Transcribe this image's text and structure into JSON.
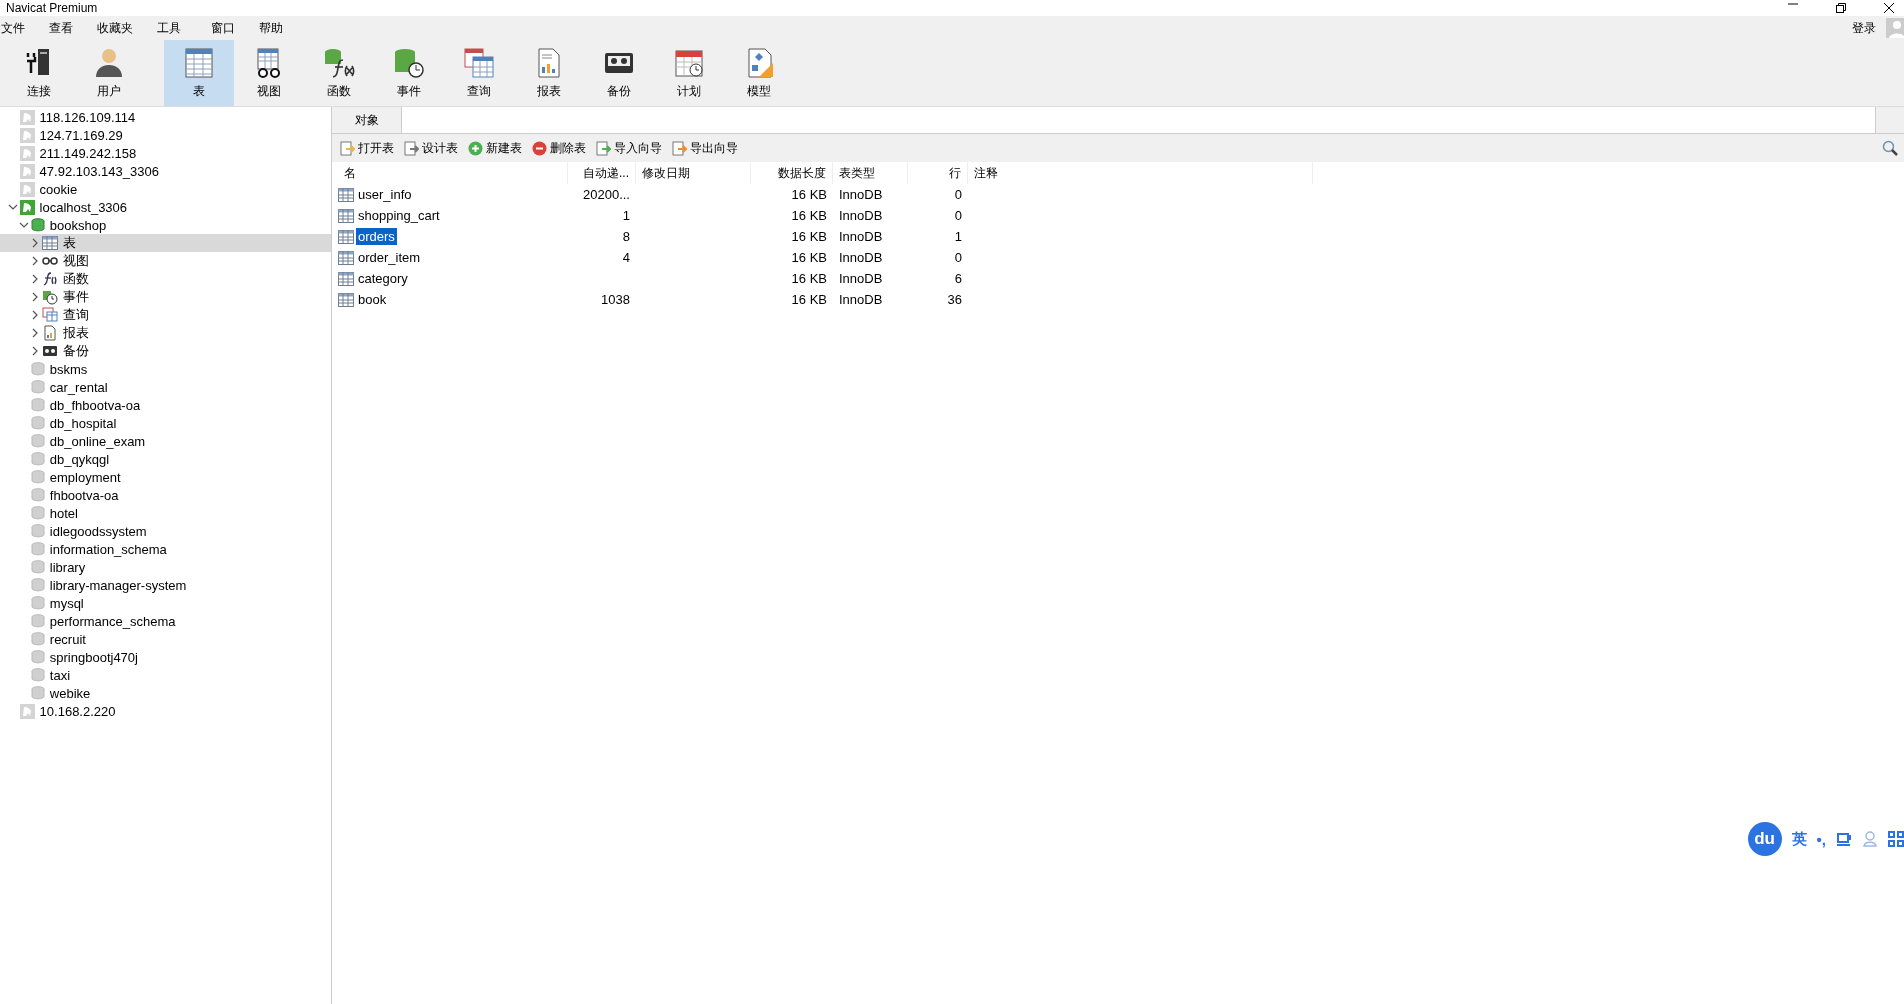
{
  "window": {
    "title": "Navicat Premium"
  },
  "menu": [
    "文件",
    "查看",
    "收藏夹",
    "工具",
    "窗口",
    "帮助"
  ],
  "login": "登录",
  "toolbar": [
    {
      "kind": "connect",
      "label": "连接",
      "selected": false
    },
    {
      "kind": "user",
      "label": "用户",
      "selected": false
    },
    {
      "kind": "table",
      "label": "表",
      "selected": true
    },
    {
      "kind": "view",
      "label": "视图",
      "selected": false
    },
    {
      "kind": "function",
      "label": "函数",
      "selected": false
    },
    {
      "kind": "event",
      "label": "事件",
      "selected": false
    },
    {
      "kind": "query",
      "label": "查询",
      "selected": false
    },
    {
      "kind": "report",
      "label": "报表",
      "selected": false
    },
    {
      "kind": "backup",
      "label": "备份",
      "selected": false
    },
    {
      "kind": "schedule",
      "label": "计划",
      "selected": false
    },
    {
      "kind": "model",
      "label": "模型",
      "selected": false
    }
  ],
  "sidebar": {
    "items": [
      {
        "kind": "connection",
        "label": "118.126.109.114",
        "connected": false,
        "selected": false
      },
      {
        "kind": "connection",
        "label": "124.71.169.29",
        "connected": false,
        "selected": false
      },
      {
        "kind": "connection",
        "label": "211.149.242.158",
        "connected": false,
        "selected": false
      },
      {
        "kind": "connection",
        "label": "47.92.103.143_3306",
        "connected": false,
        "selected": false
      },
      {
        "kind": "connection",
        "label": "cookie",
        "connected": false,
        "selected": false
      },
      {
        "kind": "connection",
        "label": "localhost_3306",
        "connected": true,
        "selected": false,
        "expanded": true,
        "children": [
          {
            "kind": "database",
            "label": "bookshop",
            "connected": true,
            "selected": false,
            "expanded": true,
            "children": [
              {
                "kind": "tables",
                "label": "表",
                "selected": true,
                "expanded": false
              },
              {
                "kind": "views",
                "label": "视图",
                "selected": false,
                "expanded": false
              },
              {
                "kind": "functions",
                "label": "函数",
                "selected": false,
                "expanded": false
              },
              {
                "kind": "events",
                "label": "事件",
                "selected": false,
                "expanded": false
              },
              {
                "kind": "queries",
                "label": "查询",
                "selected": false,
                "expanded": false
              },
              {
                "kind": "reports",
                "label": "报表",
                "selected": false,
                "expanded": false
              },
              {
                "kind": "backups",
                "label": "备份",
                "selected": false,
                "expanded": false
              }
            ]
          },
          {
            "kind": "database",
            "label": "bskms",
            "connected": false,
            "selected": false
          },
          {
            "kind": "database",
            "label": "car_rental",
            "connected": false,
            "selected": false
          },
          {
            "kind": "database",
            "label": "db_fhbootva-oa",
            "connected": false,
            "selected": false
          },
          {
            "kind": "database",
            "label": "db_hospital",
            "connected": false,
            "selected": false
          },
          {
            "kind": "database",
            "label": "db_online_exam",
            "connected": false,
            "selected": false
          },
          {
            "kind": "database",
            "label": "db_qykqgl",
            "connected": false,
            "selected": false
          },
          {
            "kind": "database",
            "label": "employment",
            "connected": false,
            "selected": false
          },
          {
            "kind": "database",
            "label": "fhbootva-oa",
            "connected": false,
            "selected": false
          },
          {
            "kind": "database",
            "label": "hotel",
            "connected": false,
            "selected": false
          },
          {
            "kind": "database",
            "label": "idlegoodssystem",
            "connected": false,
            "selected": false
          },
          {
            "kind": "database",
            "label": "information_schema",
            "connected": false,
            "selected": false
          },
          {
            "kind": "database",
            "label": "library",
            "connected": false,
            "selected": false
          },
          {
            "kind": "database",
            "label": "library-manager-system",
            "connected": false,
            "selected": false
          },
          {
            "kind": "database",
            "label": "mysql",
            "connected": false,
            "selected": false
          },
          {
            "kind": "database",
            "label": "performance_schema",
            "connected": false,
            "selected": false
          },
          {
            "kind": "database",
            "label": "recruit",
            "connected": false,
            "selected": false
          },
          {
            "kind": "database",
            "label": "springbootj470j",
            "connected": false,
            "selected": false
          },
          {
            "kind": "database",
            "label": "taxi",
            "connected": false,
            "selected": false
          },
          {
            "kind": "database",
            "label": "webike",
            "connected": false,
            "selected": false
          }
        ]
      },
      {
        "kind": "connection",
        "label": "10.168.2.220",
        "connected": false,
        "selected": false
      }
    ]
  },
  "tabs": [
    {
      "label": "对象",
      "selected": true
    }
  ],
  "actions": [
    {
      "kind": "open",
      "label": "打开表"
    },
    {
      "kind": "design",
      "label": "设计表"
    },
    {
      "kind": "new",
      "label": "新建表"
    },
    {
      "kind": "delete",
      "label": "删除表"
    },
    {
      "kind": "import",
      "label": "导入向导"
    },
    {
      "kind": "export",
      "label": "导出向导"
    }
  ],
  "table": {
    "columns": [
      "名",
      "自动递...",
      "修改日期",
      "数据长度",
      "表类型",
      "行",
      "注释"
    ],
    "rows": [
      {
        "name": "user_info",
        "auto_increment": "20200...",
        "data_length": "16 KB",
        "engine": "InnoDB",
        "rows": "0",
        "selected": false
      },
      {
        "name": "shopping_cart",
        "auto_increment": "1",
        "data_length": "16 KB",
        "engine": "InnoDB",
        "rows": "0",
        "selected": false
      },
      {
        "name": "orders",
        "auto_increment": "8",
        "data_length": "16 KB",
        "engine": "InnoDB",
        "rows": "1",
        "selected": true
      },
      {
        "name": "order_item",
        "auto_increment": "4",
        "data_length": "16 KB",
        "engine": "InnoDB",
        "rows": "0",
        "selected": false
      },
      {
        "name": "category",
        "data_length": "16 KB",
        "engine": "InnoDB",
        "rows": "6",
        "selected": false
      },
      {
        "name": "book",
        "auto_increment": "1038",
        "data_length": "16 KB",
        "engine": "InnoDB",
        "rows": "36",
        "selected": false
      }
    ]
  },
  "ime_bar": {
    "logo": "du",
    "mode": "英",
    "punct": "•,"
  }
}
